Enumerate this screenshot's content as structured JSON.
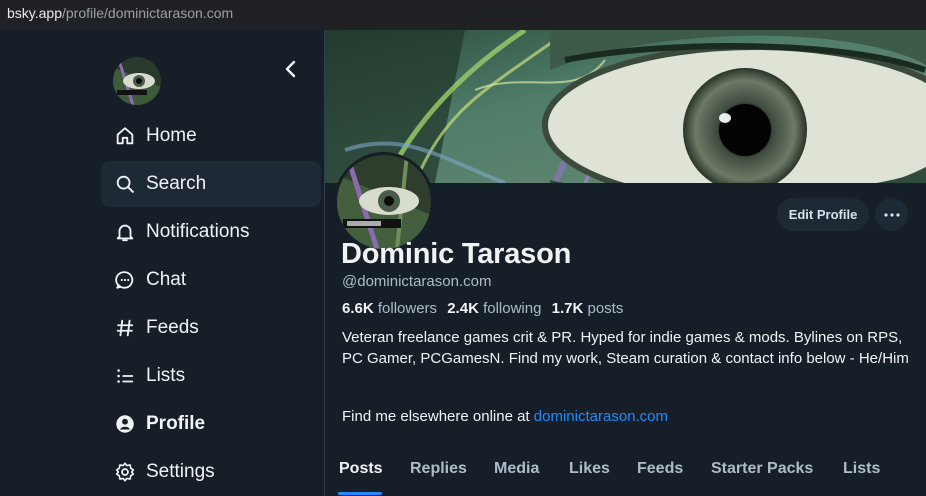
{
  "browser": {
    "url_host": "bsky.app",
    "url_path": "/profile/dominictarason.com"
  },
  "sidebar": {
    "items": [
      {
        "label": "Home",
        "icon": "home-icon"
      },
      {
        "label": "Search",
        "icon": "search-icon"
      },
      {
        "label": "Notifications",
        "icon": "bell-icon"
      },
      {
        "label": "Chat",
        "icon": "chat-icon"
      },
      {
        "label": "Feeds",
        "icon": "hash-icon"
      },
      {
        "label": "Lists",
        "icon": "list-icon"
      },
      {
        "label": "Profile",
        "icon": "person-icon"
      },
      {
        "label": "Settings",
        "icon": "gear-icon"
      }
    ],
    "hovered": "Search",
    "active": "Profile"
  },
  "profile": {
    "display_name": "Dominic Tarason",
    "handle": "@dominictarason.com",
    "followers_count": "6.6K",
    "followers_label": "followers",
    "following_count": "2.4K",
    "following_label": "following",
    "posts_count": "1.7K",
    "posts_label": "posts",
    "bio": "Veteran freelance games crit & PR. Hyped for indie games & mods. Bylines on RPS, PC Gamer, PCGamesN. Find my work, Steam curation & contact info below - He/Him",
    "bio_prefix": "Find me elsewhere online at",
    "bio_link": "dominictarason.com",
    "edit_button": "Edit Profile"
  },
  "tabs": [
    "Posts",
    "Replies",
    "Media",
    "Likes",
    "Feeds",
    "Starter Packs",
    "Lists"
  ],
  "active_tab": "Posts",
  "colors": {
    "background": "#161e27",
    "accent": "#208bfe",
    "muted_text": "#aebbc9"
  }
}
